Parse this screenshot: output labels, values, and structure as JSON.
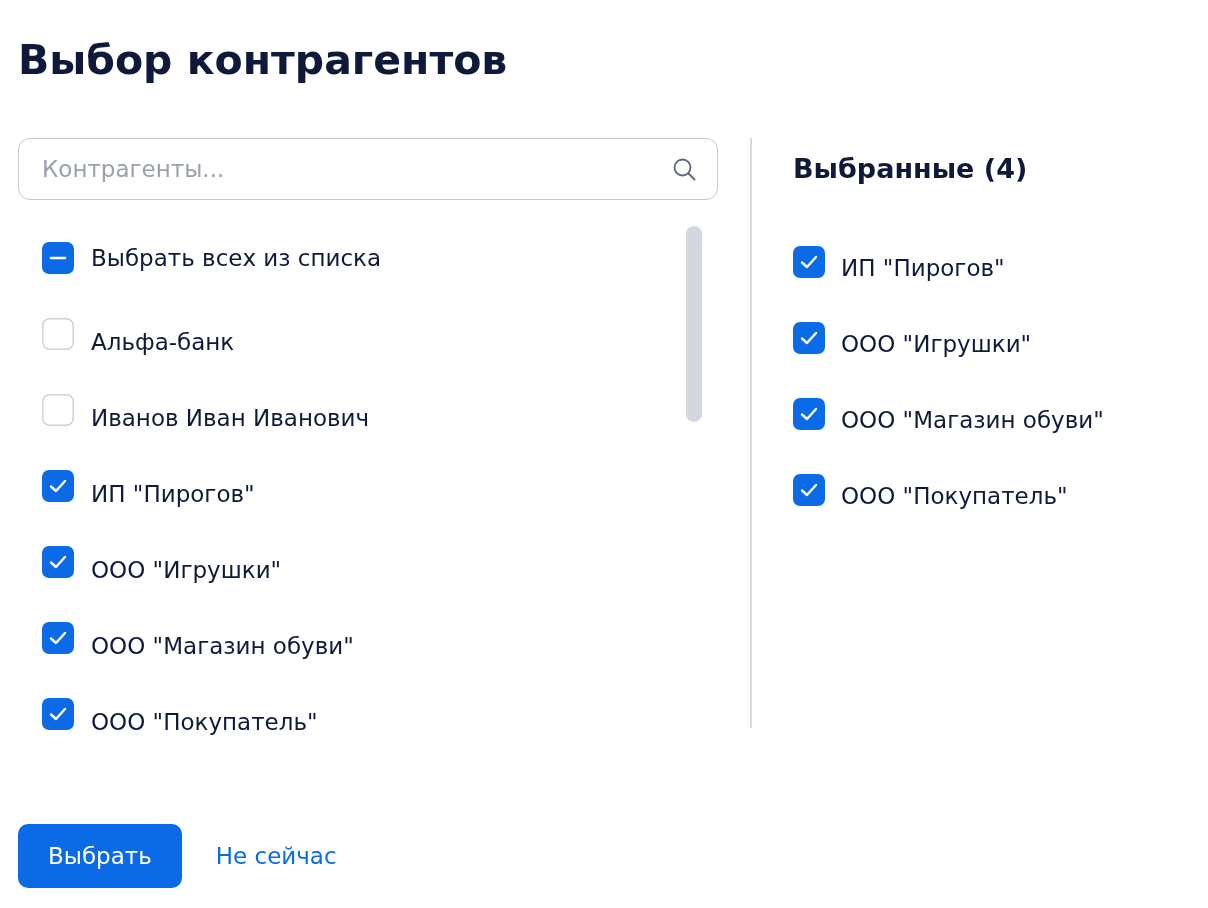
{
  "title": "Выбор контрагентов",
  "search": {
    "placeholder": "Контрагенты..."
  },
  "list": {
    "select_all": {
      "label": "Выбрать всех из списка",
      "indeterminate": true
    },
    "items": [
      {
        "label": "Альфа-банк",
        "checked": false
      },
      {
        "label": "Иванов Иван Иванович",
        "checked": false
      },
      {
        "label": "ИП \"Пирогов\"",
        "checked": true
      },
      {
        "label": "ООО \"Игрушки\"",
        "checked": true
      },
      {
        "label": "ООО \"Магазин обуви\"",
        "checked": true
      },
      {
        "label": "ООО \"Покупатель\"",
        "checked": true
      }
    ]
  },
  "selected_panel": {
    "heading": "Выбранные (4)",
    "items": [
      {
        "label": "ИП \"Пирогов\"",
        "checked": true
      },
      {
        "label": "ООО \"Игрушки\"",
        "checked": true
      },
      {
        "label": "ООО \"Магазин обуви\"",
        "checked": true
      },
      {
        "label": "ООО \"Покупатель\"",
        "checked": true
      }
    ]
  },
  "buttons": [
    {
      "label": "Выбрать",
      "kind": "primary"
    },
    {
      "label": "Не сейчас",
      "kind": "link"
    }
  ]
}
